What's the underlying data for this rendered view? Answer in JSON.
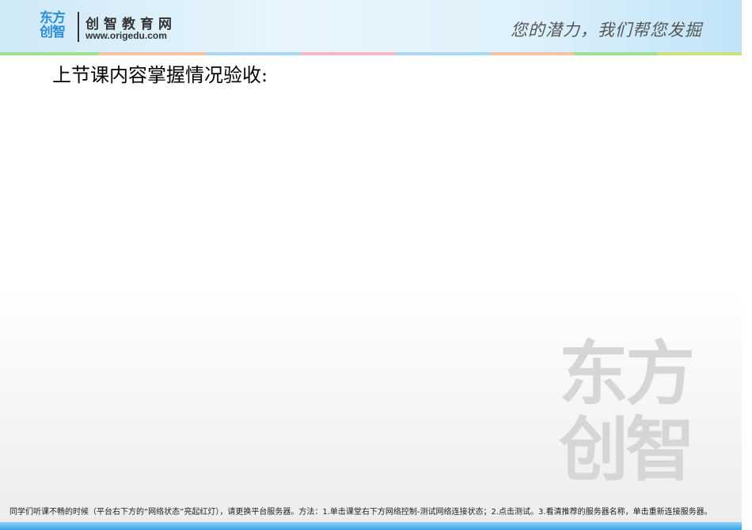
{
  "header": {
    "logo_mark": "东方创智",
    "brand_name": "创智教育网",
    "brand_url": "www.origedu.com",
    "slogan": "您的潜力，我们帮您发掘"
  },
  "slide": {
    "title": "上节课内容掌握情况验收:"
  },
  "watermark": "东方创智",
  "footer": {
    "notice": "同学们听课不畅的时候（平台右下方的“网络状态”亮起红灯），请更换平台服务器。方法：1.单击课堂右下方网络控制-测试网络连接状态；2.点击测试。3.看清推荐的服务器名称，单击重新连接服务器。"
  },
  "colors": {
    "stripe": [
      "#9de08f",
      "#f5c3a3",
      "#a9d8f3",
      "#f5b7c8",
      "#a9d8f3",
      "#f5c3a3",
      "#9de08f",
      "#cde27e"
    ],
    "footer_bar": "#3aa4e6",
    "logo": "#2b8fd6"
  }
}
